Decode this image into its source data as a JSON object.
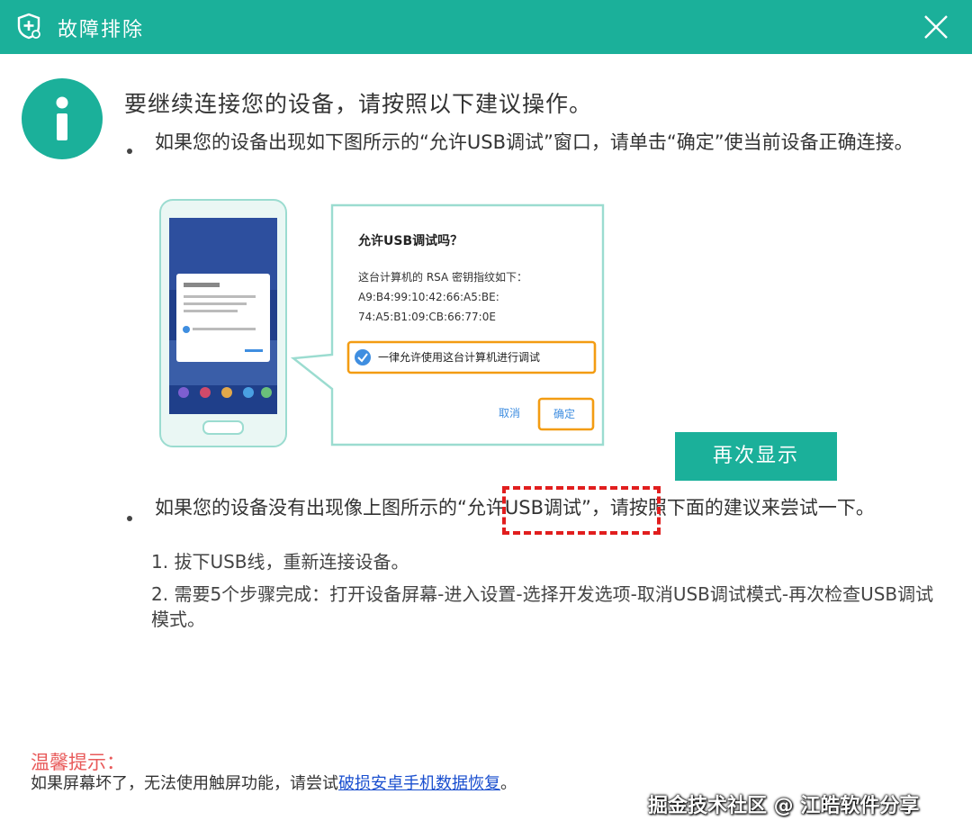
{
  "window": {
    "title": "故障排除",
    "icon": "shield-plus-icon",
    "close_icon": "close-icon"
  },
  "colors": {
    "accent": "#1bb09a",
    "warning_red": "#e11e1e",
    "tip_red": "#e85a5a",
    "link_blue": "#1a4fcf",
    "highlight_orange": "#f39c12"
  },
  "main": {
    "heading": "要继续连接您的设备，请按照以下建议操作。",
    "bullet1": "如果您的设备出现如下图所示的“允许USB调试”窗口，请单击“确定”使当前设备正确连接。",
    "dialog": {
      "title": "允许USB调试吗？",
      "line1": "这台计算机的 RSA 密钥指纹如下：",
      "line2": "A9:B4:99:10:42:66:A5:BE:",
      "line3": "74:A5:B1:09:CB:66:77:0E",
      "checkbox_label": "一律允许使用这台计算机进行调试",
      "cancel": "取消",
      "ok": "确定"
    },
    "show_again_button": "再次显示",
    "bullet2": "如果您的设备没有出现像上图所示的“允许USB调试”，请按照下面的建议来尝试一下。",
    "steps": [
      "1. 拔下USB线，重新连接设备。",
      "2. 需要5个步骤完成：打开设备屏幕-进入设置-选择开发选项-取消USB调试模式-再次检查USB调试模式。"
    ]
  },
  "tip": {
    "title": "温馨提示：",
    "text": "如果屏幕坏了，无法使用触屏功能，请尝试",
    "link": "破损安卓手机数据恢复",
    "suffix": "。"
  },
  "watermark": "掘金技术社区 @ 江皓软件分享"
}
